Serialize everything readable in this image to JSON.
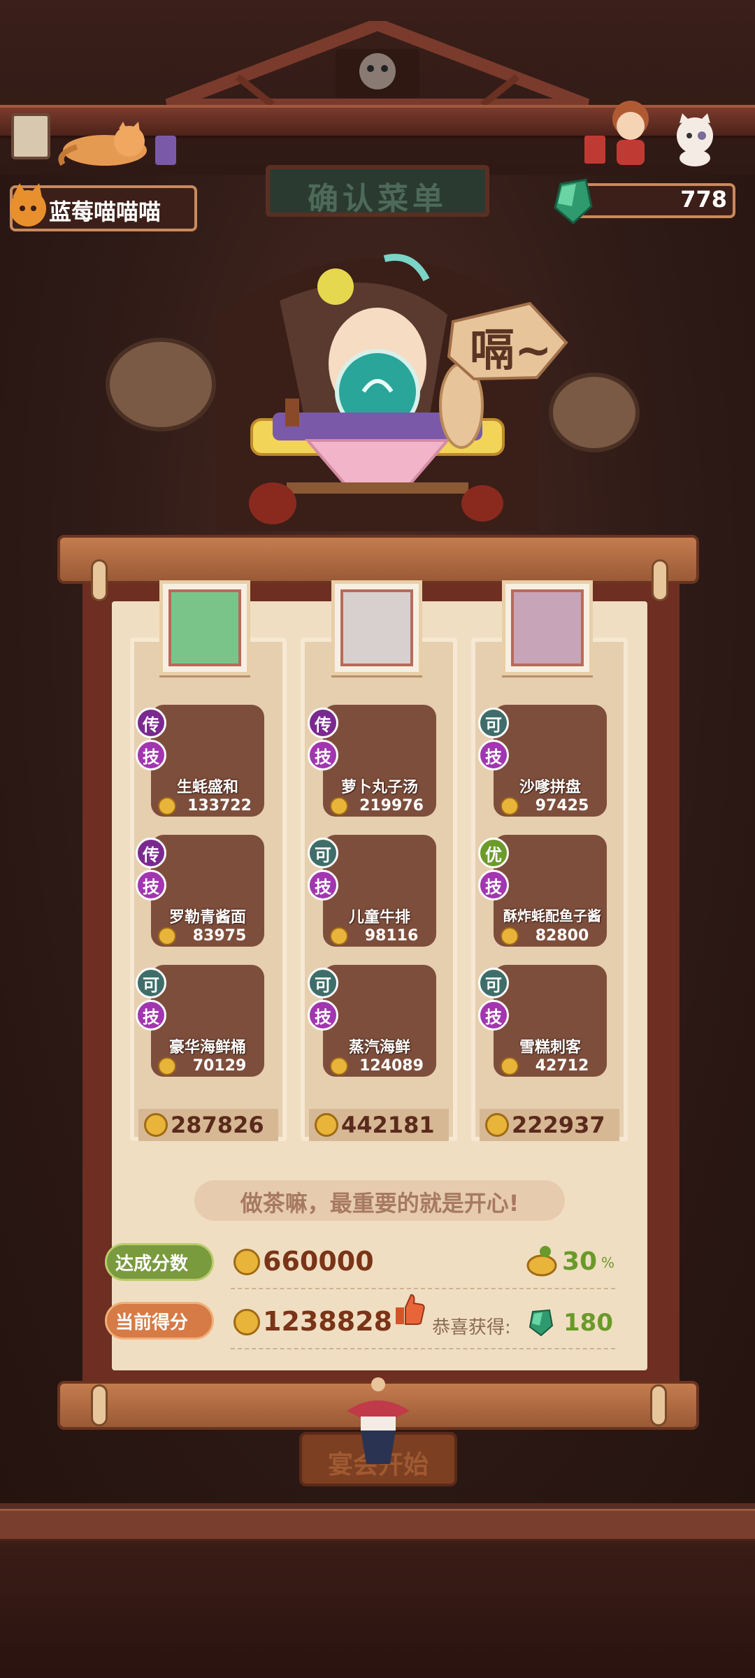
{
  "header": {
    "title": "确认菜单",
    "user_name": "蓝莓喵喵喵",
    "gem_count": "778",
    "speech": "嗝~"
  },
  "columns": [
    {
      "dishes": [
        {
          "tag1": "传",
          "tag2": "技",
          "name": "生蚝盛和",
          "price": "133722",
          "rarity": "chuan"
        },
        {
          "tag1": "传",
          "tag2": "技",
          "name": "罗勒青酱面",
          "price": "83975",
          "rarity": "chuan"
        },
        {
          "tag1": "可",
          "tag2": "技",
          "name": "豪华海鲜桶",
          "price": "70129",
          "rarity": "ke"
        }
      ],
      "total": "287826"
    },
    {
      "dishes": [
        {
          "tag1": "传",
          "tag2": "技",
          "name": "萝卜丸子汤",
          "price": "219976",
          "rarity": "chuan"
        },
        {
          "tag1": "可",
          "tag2": "技",
          "name": "儿童牛排",
          "price": "98116",
          "rarity": "ke"
        },
        {
          "tag1": "可",
          "tag2": "技",
          "name": "蒸汽海鲜",
          "price": "124089",
          "rarity": "ke"
        }
      ],
      "total": "442181"
    },
    {
      "dishes": [
        {
          "tag1": "可",
          "tag2": "技",
          "name": "沙嗲拼盘",
          "price": "97425",
          "rarity": "ke"
        },
        {
          "tag1": "优",
          "tag2": "技",
          "name": "酥炸蚝配鱼子酱",
          "price": "82800",
          "rarity": "you"
        },
        {
          "tag1": "可",
          "tag2": "技",
          "name": "雪糕刺客",
          "price": "42712",
          "rarity": "ke"
        }
      ],
      "total": "222937"
    }
  ],
  "motto": "做茶嘛，最重要的就是开心!",
  "score": {
    "target_label": "达成分数",
    "target_value": "660000",
    "bonus_percent": "30",
    "bonus_percent_sign": "%",
    "current_label": "当前得分",
    "current_value": "1238828",
    "reward_label": "恭喜获得:",
    "reward_value": "180"
  },
  "start_button": "宴会开始",
  "colors": {
    "legend_tag": "#7a2a8e",
    "skill_tag": "#a236b0",
    "common_tag": "#3f6e6a",
    "excellent_tag": "#6c9b2a",
    "target_label_bg": "#7a9a3e",
    "current_label_bg": "#d67a46"
  },
  "icons": {
    "gem": "green-gem-icon",
    "coin": "gold-coin-icon",
    "thumb": "thumbs-up-icon",
    "bonus": "bonus-pot-icon"
  }
}
